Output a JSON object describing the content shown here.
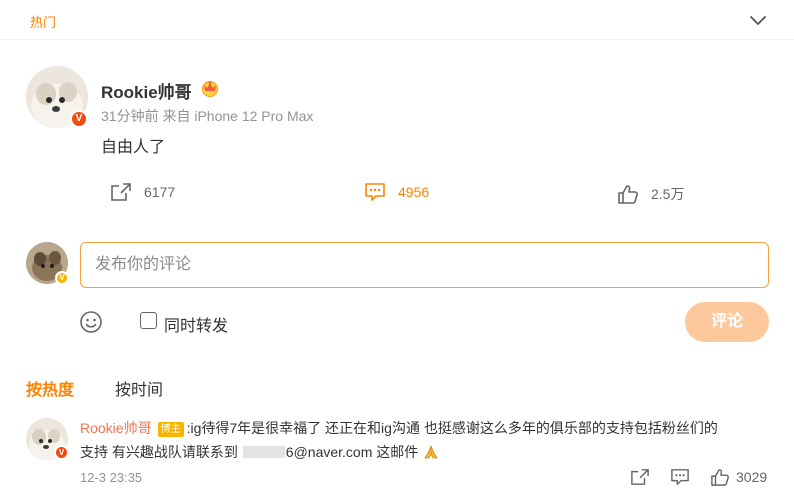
{
  "section": {
    "label": "热门"
  },
  "post": {
    "author": "Rookie帅哥",
    "meta": "31分钟前 来自 iPhone 12 Pro Max",
    "text": "自由人了",
    "repost_count": "6177",
    "comment_count": "4956",
    "like_count": "2.5万"
  },
  "composer": {
    "placeholder": "发布你的评论",
    "repost_label": "同时转发",
    "submit_label": "评论"
  },
  "sort": {
    "hot": "按热度",
    "time": "按时间"
  },
  "comment": {
    "author": "Rookie帅哥",
    "tag": "博主",
    "line1": ":ig待得7年是很幸福了 还正在和ig沟通 也挺感谢这么多年的俱乐部的支持包括粉丝们的",
    "line2_prefix": "支持 有兴趣战队请联系到 ",
    "line2_email_suffix": "6@naver.com 这邮件",
    "time": "12-3 23:35",
    "like_count": "3029"
  },
  "colors": {
    "accent": "#ff8200",
    "name_link": "#eb7350",
    "badge_red": "#f04c10",
    "badge_gold": "#f7b500"
  },
  "icons": [
    "chevron-down-icon",
    "crown-icon",
    "share-icon",
    "comment-icon",
    "like-icon",
    "emoji-icon",
    "pray-icon"
  ]
}
